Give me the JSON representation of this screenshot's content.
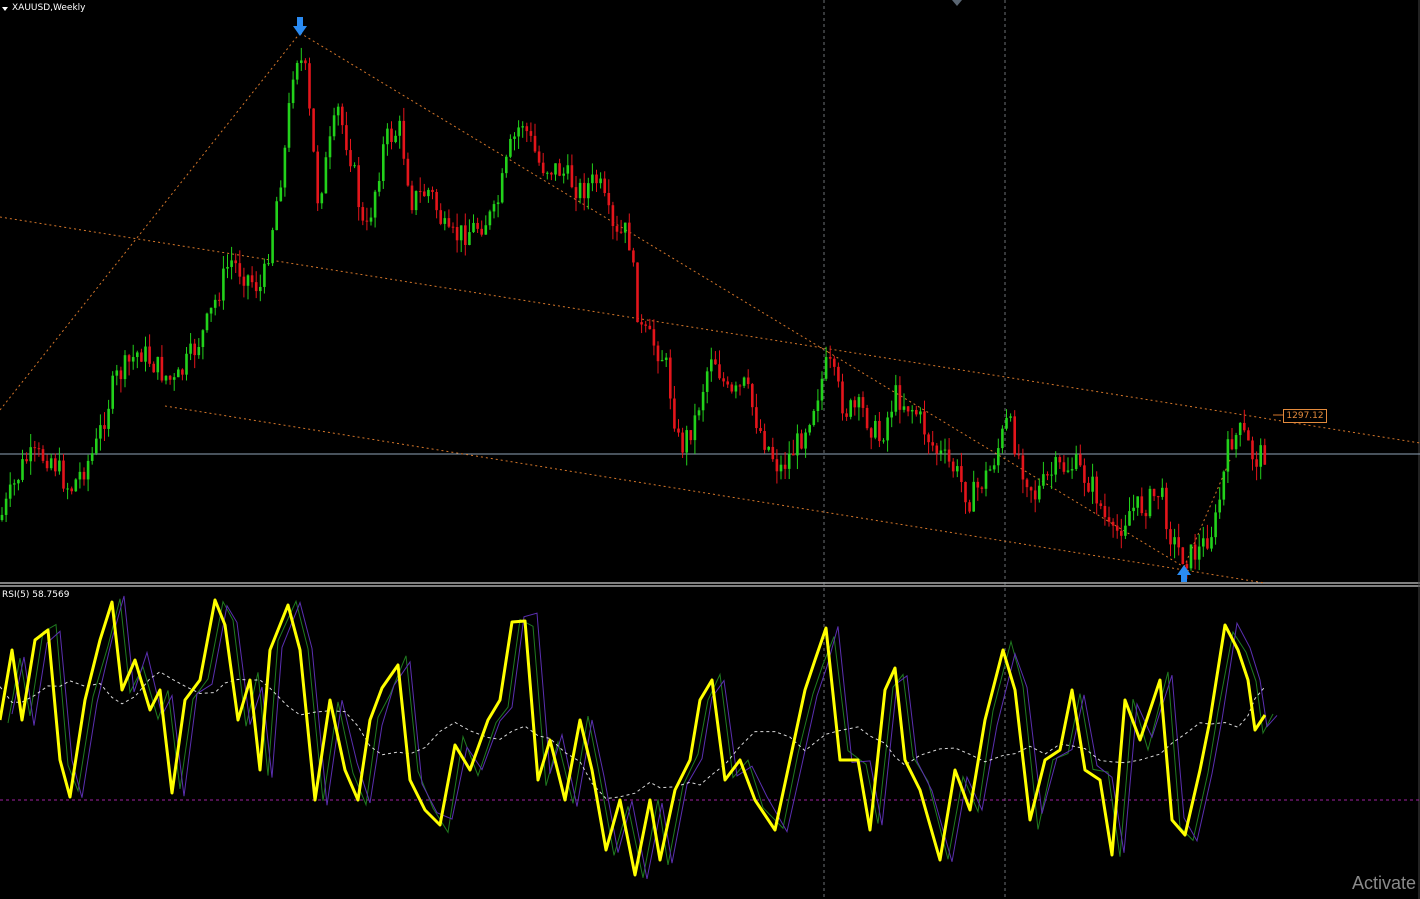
{
  "chart_header": {
    "symbol_timeframe": "XAUUSD,Weekly"
  },
  "indicator": {
    "label": "RSI(5) 58.7569"
  },
  "price_tag": "1297.12",
  "watermark": "Activate",
  "colors": {
    "background": "#000000",
    "bull_candle": "#22d11b",
    "bear_candle": "#e3151b",
    "trendline": "#d4762a",
    "rsi_main": "#ffff00",
    "rsi_signal": "#ffffff",
    "rsi_green": "#1f7a1f",
    "rsi_purple": "#5a2fb0",
    "level_line": "#a020a0",
    "grid_line": "#9aa0a6",
    "arrow": "#2a8bf2"
  },
  "icons": [
    "down-arrow-signal-icon",
    "up-arrow-signal-icon",
    "dropdown-triangle-icon"
  ]
}
